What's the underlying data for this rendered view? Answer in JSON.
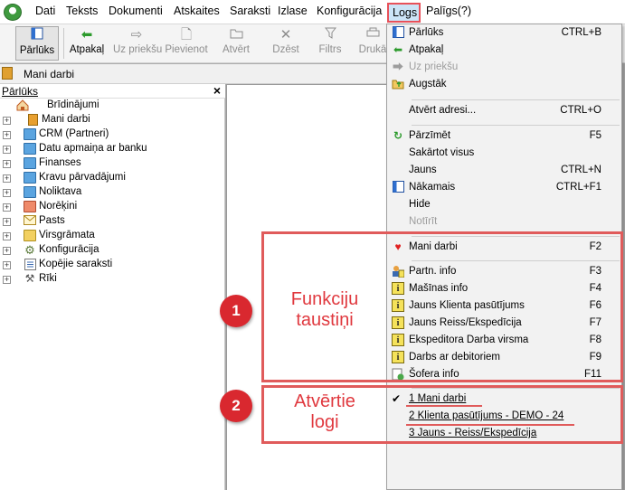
{
  "menubar": {
    "items": [
      "Dati",
      "Teksts",
      "Dokumenti",
      "Atskaites",
      "Saraksti",
      "Izlase",
      "Konfigurācija",
      "Logs",
      "Palīgs(?)"
    ]
  },
  "toolbar": {
    "buttons": [
      {
        "label": "Pārlūks",
        "icon": "browser-panel-icon",
        "enabled": true
      },
      {
        "label": "Atpakaļ",
        "icon": "arrow-left-icon",
        "enabled": true
      },
      {
        "label": "Uz priekšu",
        "icon": "arrow-right-icon",
        "enabled": false
      },
      {
        "label": "Pievienot",
        "icon": "new-document-icon",
        "enabled": false
      },
      {
        "label": "Atvērt",
        "icon": "open-folder-icon",
        "enabled": false
      },
      {
        "label": "Dzēst",
        "icon": "delete-x-icon",
        "enabled": false
      },
      {
        "label": "Filtrs",
        "icon": "filter-funnel-icon",
        "enabled": false
      },
      {
        "label": "Drukā",
        "icon": "printer-icon",
        "enabled": false
      }
    ]
  },
  "tabstrip": {
    "active_tab": "Mani darbi"
  },
  "browser_panel": {
    "title": "Pārlūks",
    "close": "×",
    "items": [
      {
        "label": "Brīdinājumi",
        "icon": "house-icon",
        "expandable": false
      },
      {
        "label": "Mani darbi",
        "icon": "my-work-icon",
        "expandable": true
      },
      {
        "label": "CRM (Partneri)",
        "icon": "folder-icon",
        "expandable": true
      },
      {
        "label": "Datu apmaiņa ar banku",
        "icon": "folder-icon",
        "expandable": true
      },
      {
        "label": "Finanses",
        "icon": "folder-icon",
        "expandable": true
      },
      {
        "label": "Kravu pārvadājumi",
        "icon": "folder-icon",
        "expandable": true
      },
      {
        "label": "Noliktava",
        "icon": "folder-icon",
        "expandable": true
      },
      {
        "label": "Norēķini",
        "icon": "folder-icon",
        "expandable": true
      },
      {
        "label": "Pasts",
        "icon": "envelope-icon",
        "expandable": true
      },
      {
        "label": "Virsgrāmata",
        "icon": "folder-icon",
        "expandable": true
      },
      {
        "label": "Konfigurācija",
        "icon": "gear-icon",
        "expandable": true
      },
      {
        "label": "Kopējie saraksti",
        "icon": "list-icon",
        "expandable": true
      },
      {
        "label": "Rīki",
        "icon": "tools-icon",
        "expandable": true
      }
    ]
  },
  "logs_menu": {
    "items": [
      {
        "label": "Pārlūks",
        "shortcut": "CTRL+B",
        "icon": "browser-panel-icon",
        "enabled": true
      },
      {
        "label": "Atpakaļ",
        "shortcut": "",
        "icon": "arrow-left-icon",
        "enabled": true
      },
      {
        "label": "Uz priekšu",
        "shortcut": "",
        "icon": "arrow-right-icon",
        "enabled": false
      },
      {
        "label": "Augstāk",
        "shortcut": "",
        "icon": "folder-up-icon",
        "enabled": true
      },
      {
        "label": "Atvērt adresi...",
        "shortcut": "CTRL+O",
        "icon": "",
        "enabled": true
      },
      {
        "label": "Pārzīmēt",
        "shortcut": "F5",
        "icon": "refresh-icon",
        "enabled": true
      },
      {
        "label": "Sakārtot visus",
        "shortcut": "",
        "icon": "",
        "enabled": true
      },
      {
        "label": "Jauns",
        "shortcut": "CTRL+N",
        "icon": "",
        "enabled": true
      },
      {
        "label": "Nākamais",
        "shortcut": "CTRL+F1",
        "icon": "next-window-icon",
        "enabled": true
      },
      {
        "label": "Hide",
        "shortcut": "",
        "icon": "",
        "enabled": true
      },
      {
        "label": "Notīrīt",
        "shortcut": "",
        "icon": "",
        "enabled": false
      },
      {
        "label": "Mani darbi",
        "shortcut": "F2",
        "icon": "heart-icon",
        "enabled": true
      },
      {
        "label": "Partn. info",
        "shortcut": "F3",
        "icon": "partner-info-icon",
        "enabled": true
      },
      {
        "label": "Mašīnas info",
        "shortcut": "F4",
        "icon": "info-icon",
        "enabled": true
      },
      {
        "label": "Jauns Klienta pasūtījums",
        "shortcut": "F6",
        "icon": "info-icon",
        "enabled": true
      },
      {
        "label": "Jauns Reiss/Ekspedīcija",
        "shortcut": "F7",
        "icon": "info-icon",
        "enabled": true
      },
      {
        "label": "Ekspeditora Darba virsma",
        "shortcut": "F8",
        "icon": "info-icon",
        "enabled": true
      },
      {
        "label": "Darbs ar debitoriem",
        "shortcut": "F9",
        "icon": "info-icon",
        "enabled": true
      },
      {
        "label": "Šofera info",
        "shortcut": "F11",
        "icon": "driver-info-icon",
        "enabled": true
      }
    ],
    "open_windows": [
      {
        "label": "1 Mani darbi",
        "checked": true
      },
      {
        "label": "2 Klienta pasūtījums - DEMO  - 24",
        "checked": false
      },
      {
        "label": "3 Jauns - Reiss/Ekspedīcija",
        "checked": false
      }
    ]
  },
  "annotations": {
    "callout1": {
      "number": "1",
      "line1": "Funkciju",
      "line2": "taustiņi"
    },
    "callout2": {
      "number": "2",
      "line1": "Atvērtie",
      "line2": "logi"
    },
    "color": "#e05b5b"
  }
}
